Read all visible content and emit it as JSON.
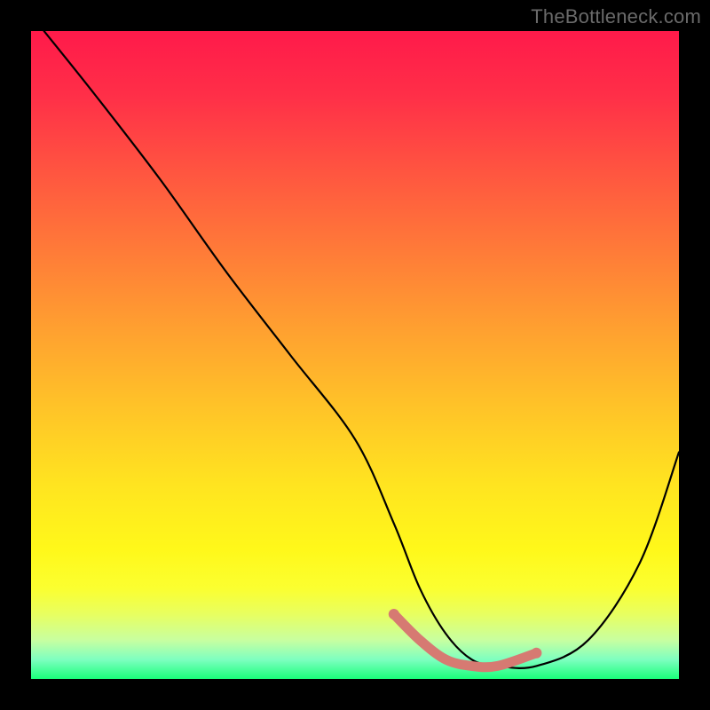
{
  "watermark": "TheBottleneck.com",
  "chart_data": {
    "type": "line",
    "title": "",
    "xlabel": "",
    "ylabel": "",
    "xlim": [
      0,
      100
    ],
    "ylim": [
      0,
      100
    ],
    "series": [
      {
        "name": "bottleneck-curve",
        "x": [
          2,
          10,
          20,
          30,
          40,
          50,
          56,
          60,
          64,
          68,
          72,
          78,
          86,
          94,
          100
        ],
        "values": [
          100,
          90,
          77,
          63,
          50,
          37,
          24,
          14,
          7,
          3,
          2,
          2,
          6,
          18,
          35
        ]
      },
      {
        "name": "optimal-range-highlight",
        "x": [
          56,
          60,
          64,
          68,
          72,
          78
        ],
        "values": [
          10,
          6,
          3,
          2,
          2,
          4
        ]
      }
    ],
    "colors": {
      "curve": "#000000",
      "highlight": "#d67a72",
      "gradient_top": "#ff1a4a",
      "gradient_bottom": "#1aff7a"
    }
  }
}
